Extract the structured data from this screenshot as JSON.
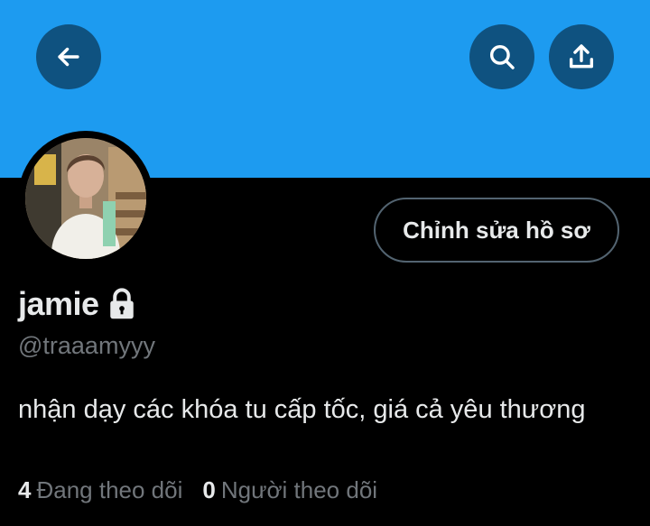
{
  "colors": {
    "banner": "#1d9bf0",
    "button_bg": "#0f5280",
    "background": "#000000",
    "primary_text": "#e7e9ea",
    "secondary_text": "#71767b",
    "border": "#536471"
  },
  "header": {
    "back_icon": "arrow-left-icon",
    "search_icon": "search-icon",
    "share_icon": "share-icon"
  },
  "profile": {
    "edit_button_label": "Chỉnh sửa hồ sơ",
    "display_name": "jamie",
    "lock_icon": "lock-icon",
    "handle": "@traaamyyy",
    "bio": "nhận dạy các khóa tu cấp tốc, giá cả yêu thương",
    "following_count": "4",
    "following_label": "Đang theo dõi",
    "followers_count": "0",
    "followers_label": "Người theo dõi"
  }
}
